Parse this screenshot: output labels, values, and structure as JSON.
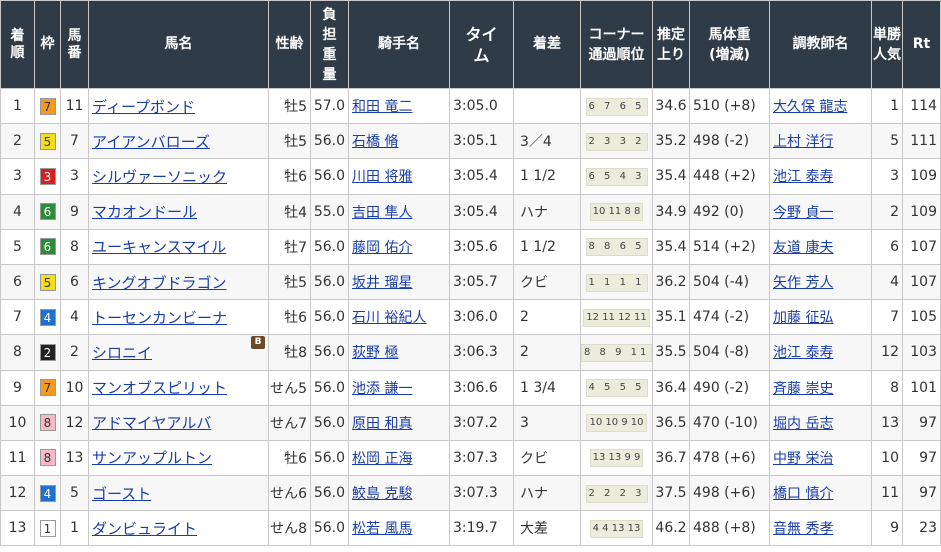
{
  "headers": {
    "chaku": "着順",
    "waku": "枠",
    "umaban": "馬番",
    "horse": "馬名",
    "sexage": "性齢",
    "weight": "負担重量",
    "jockey": "騎手名",
    "time": "タイム",
    "margin": "着差",
    "corner": "コーナー通過順位",
    "last3f": "推定上り",
    "bodyweight": "馬体重(増減)",
    "trainer": "調教師名",
    "popularity": "単勝人気",
    "rt": "Rt"
  },
  "waku_colors": {
    "1": {
      "bg": "#ffffff",
      "fg": "#333333"
    },
    "2": {
      "bg": "#222222",
      "fg": "#ffffff"
    },
    "3": {
      "bg": "#d62020",
      "fg": "#ffffff"
    },
    "4": {
      "bg": "#1f6fd1",
      "fg": "#ffffff"
    },
    "5": {
      "bg": "#f5dc1e",
      "fg": "#333333"
    },
    "6": {
      "bg": "#2e8b3a",
      "fg": "#ffffff"
    },
    "7": {
      "bg": "#f59a20",
      "fg": "#333333"
    },
    "8": {
      "bg": "#f5b9c8",
      "fg": "#333333"
    }
  },
  "rows": [
    {
      "chaku": "1",
      "waku": "7",
      "umaban": "11",
      "horse": "ディープボンド",
      "blinker": "",
      "sexage": "牡5",
      "weight": "57.0",
      "jockey": "和田 竜二",
      "time": "3:05.0",
      "margin": "",
      "corner": "6 7 6 5",
      "corner_tight": false,
      "last3f": "34.6",
      "bodyweight": "510 (+8)",
      "trainer": "大久保 龍志",
      "popularity": "1",
      "rt": "114"
    },
    {
      "chaku": "2",
      "waku": "5",
      "umaban": "7",
      "horse": "アイアンバローズ",
      "blinker": "",
      "sexage": "牡5",
      "weight": "56.0",
      "jockey": "石橋 脩",
      "time": "3:05.1",
      "margin": "3／4",
      "corner": "2 3 3 2",
      "corner_tight": false,
      "last3f": "35.2",
      "bodyweight": "498 (-2)",
      "trainer": "上村 洋行",
      "popularity": "5",
      "rt": "111"
    },
    {
      "chaku": "3",
      "waku": "3",
      "umaban": "3",
      "horse": "シルヴァーソニック",
      "blinker": "",
      "sexage": "牡6",
      "weight": "56.0",
      "jockey": "川田 将雅",
      "time": "3:05.4",
      "margin": "1 1/2",
      "corner": "6 5 4 3",
      "corner_tight": false,
      "last3f": "35.4",
      "bodyweight": "448 (+2)",
      "trainer": "池江 泰寿",
      "popularity": "3",
      "rt": "109"
    },
    {
      "chaku": "4",
      "waku": "6",
      "umaban": "9",
      "horse": "マカオンドール",
      "blinker": "",
      "sexage": "牡4",
      "weight": "55.0",
      "jockey": "吉田 隼人",
      "time": "3:05.4",
      "margin": "ハナ",
      "corner": "10 11 8 8",
      "corner_tight": true,
      "last3f": "34.9",
      "bodyweight": "492 (0)",
      "trainer": "今野 貞一",
      "popularity": "2",
      "rt": "109"
    },
    {
      "chaku": "5",
      "waku": "6",
      "umaban": "8",
      "horse": "ユーキャンスマイル",
      "blinker": "",
      "sexage": "牡7",
      "weight": "56.0",
      "jockey": "藤岡 佑介",
      "time": "3:05.6",
      "margin": "1 1/2",
      "corner": "8 8 6 5",
      "corner_tight": false,
      "last3f": "35.4",
      "bodyweight": "514 (+2)",
      "trainer": "友道 康夫",
      "popularity": "6",
      "rt": "107"
    },
    {
      "chaku": "6",
      "waku": "5",
      "umaban": "6",
      "horse": "キングオブドラゴン",
      "blinker": "",
      "sexage": "牡5",
      "weight": "56.0",
      "jockey": "坂井 瑠星",
      "time": "3:05.7",
      "margin": "クビ",
      "corner": "1 1 1 1",
      "corner_tight": false,
      "last3f": "36.2",
      "bodyweight": "504 (-4)",
      "trainer": "矢作 芳人",
      "popularity": "4",
      "rt": "107"
    },
    {
      "chaku": "7",
      "waku": "4",
      "umaban": "4",
      "horse": "トーセンカンビーナ",
      "blinker": "",
      "sexage": "牡6",
      "weight": "56.0",
      "jockey": "石川 裕紀人",
      "time": "3:06.0",
      "margin": "2",
      "corner": "12 11 12 11",
      "corner_tight": true,
      "last3f": "35.1",
      "bodyweight": "474 (-2)",
      "trainer": "加藤 征弘",
      "popularity": "7",
      "rt": "105"
    },
    {
      "chaku": "8",
      "waku": "2",
      "umaban": "2",
      "horse": "シロニイ",
      "blinker": "B",
      "sexage": "牡8",
      "weight": "56.0",
      "jockey": "荻野 極",
      "time": "3:06.3",
      "margin": "2",
      "corner": "8 8 9 11",
      "corner_tight": false,
      "last3f": "35.5",
      "bodyweight": "504 (-8)",
      "trainer": "池江 泰寿",
      "popularity": "12",
      "rt": "103"
    },
    {
      "chaku": "9",
      "waku": "7",
      "umaban": "10",
      "horse": "マンオブスピリット",
      "blinker": "",
      "sexage": "せん5",
      "weight": "56.0",
      "jockey": "池添 謙一",
      "time": "3:06.6",
      "margin": "1 3/4",
      "corner": "4 5 5 5",
      "corner_tight": false,
      "last3f": "36.4",
      "bodyweight": "490 (-2)",
      "trainer": "斉藤 崇史",
      "popularity": "8",
      "rt": "101"
    },
    {
      "chaku": "10",
      "waku": "8",
      "umaban": "12",
      "horse": "アドマイヤアルバ",
      "blinker": "",
      "sexage": "せん7",
      "weight": "56.0",
      "jockey": "原田 和真",
      "time": "3:07.2",
      "margin": "3",
      "corner": "10 10 9 10",
      "corner_tight": true,
      "last3f": "36.5",
      "bodyweight": "470 (-10)",
      "trainer": "堀内 岳志",
      "popularity": "13",
      "rt": "97"
    },
    {
      "chaku": "11",
      "waku": "8",
      "umaban": "13",
      "horse": "サンアップルトン",
      "blinker": "",
      "sexage": "牡6",
      "weight": "56.0",
      "jockey": "松岡 正海",
      "time": "3:07.3",
      "margin": "クビ",
      "corner": "13 13 9 9",
      "corner_tight": true,
      "last3f": "36.7",
      "bodyweight": "478 (+6)",
      "trainer": "中野 栄治",
      "popularity": "10",
      "rt": "97"
    },
    {
      "chaku": "12",
      "waku": "4",
      "umaban": "5",
      "horse": "ゴースト",
      "blinker": "",
      "sexage": "せん6",
      "weight": "56.0",
      "jockey": "鮫島 克駿",
      "time": "3:07.3",
      "margin": "ハナ",
      "corner": "2 2 2 3",
      "corner_tight": false,
      "last3f": "37.5",
      "bodyweight": "498 (+6)",
      "trainer": "橋口 慎介",
      "popularity": "11",
      "rt": "97"
    },
    {
      "chaku": "13",
      "waku": "1",
      "umaban": "1",
      "horse": "ダンビュライト",
      "blinker": "",
      "sexage": "せん8",
      "weight": "56.0",
      "jockey": "松若 風馬",
      "time": "3:19.7",
      "margin": "大差",
      "corner": "4 4 13 13",
      "corner_tight": true,
      "last3f": "46.2",
      "bodyweight": "488 (+8)",
      "trainer": "音無 秀孝",
      "popularity": "9",
      "rt": "23"
    }
  ]
}
